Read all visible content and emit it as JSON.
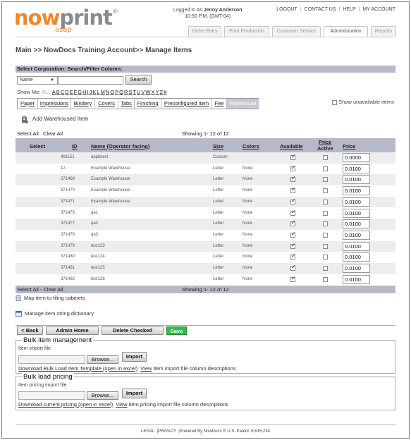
{
  "logo": {
    "now": "now",
    "print": "print",
    "tm": "®",
    "asap": "asap"
  },
  "login": {
    "prefix": "Logged In As:",
    "user": "Jenny Anderson",
    "time": "10:50 P.M. (GMT-04)"
  },
  "toplinks": [
    "LOGOUT",
    "CONTACT US",
    "HELP",
    "MY ACCOUNT"
  ],
  "tabs": [
    "Order Entry",
    "Print Production",
    "Customer Service",
    "Administration",
    "Reports"
  ],
  "active_tab": "Administration",
  "breadcrumb": "Main >> NowDocs Training Account>> Manage Items",
  "select_header": "Select Corporation: Search/Filter Column:",
  "filter": {
    "column": "Name",
    "search_value": "",
    "search_label": "Search"
  },
  "showme": {
    "label": "Show Me:",
    "all": "ALL",
    "letters": [
      "A",
      "B",
      "C",
      "D",
      "E",
      "F",
      "G",
      "H",
      "I",
      "J",
      "K",
      "L",
      "M",
      "N",
      "O",
      "P",
      "Q",
      "R",
      "S",
      "T",
      "U",
      "V",
      "W",
      "X",
      "Y",
      "Z",
      "#"
    ]
  },
  "category_tabs": [
    "Paper",
    "Impressions",
    "Bindery",
    "Covers",
    "Tabs",
    "Finishing",
    "Preconfigured Item",
    "Fee",
    "Warehouse"
  ],
  "active_category": "Warehouse",
  "show_unavailable_label": "Show unavailable items",
  "add_item_label": "Add Warehoused Item",
  "grid": {
    "select_all": "Select All",
    "clear_all": "Clear All",
    "showing": "Showing 1- 12 of 12",
    "bottom_select": "Select All  - Clear All",
    "headers": {
      "select": "Select",
      "id": "ID",
      "name": "Name (Operator facing)",
      "size": "Size",
      "colors": "Colors",
      "available": "Available",
      "price_active_1": "Price",
      "price_active_2": "Active",
      "price": "Price"
    },
    "rows": [
      {
        "id": "491151",
        "name": "appletest",
        "size": "Custom",
        "colors": "",
        "available": true,
        "price_active": false,
        "price": "0.0000"
      },
      {
        "id": "12",
        "name": "Example Warehouse",
        "size": "Letter",
        "colors": "None",
        "available": true,
        "price_active": false,
        "price": "0.0100"
      },
      {
        "id": "371469",
        "name": "Example Warehouse",
        "size": "Letter",
        "colors": "None",
        "available": true,
        "price_active": false,
        "price": "0.0100"
      },
      {
        "id": "371470",
        "name": "Example Warehouse",
        "size": "Letter",
        "colors": "None",
        "available": true,
        "price_active": false,
        "price": "0.0100"
      },
      {
        "id": "371471",
        "name": "Example Warehouse",
        "size": "Letter",
        "colors": "None",
        "available": true,
        "price_active": false,
        "price": "0.0100"
      },
      {
        "id": "371476",
        "name": "qa1",
        "size": "Letter",
        "colors": "None",
        "available": true,
        "price_active": false,
        "price": "0.0100"
      },
      {
        "id": "371477",
        "name": "qa2",
        "size": "Letter",
        "colors": "None",
        "available": true,
        "price_active": false,
        "price": "0.0100"
      },
      {
        "id": "371478",
        "name": "qa3",
        "size": "Letter",
        "colors": "None",
        "available": true,
        "price_active": false,
        "price": "0.0100"
      },
      {
        "id": "371479",
        "name": "test123",
        "size": "Letter",
        "colors": "None",
        "available": true,
        "price_active": false,
        "price": "0.0100"
      },
      {
        "id": "371480",
        "name": "test124",
        "size": "Letter",
        "colors": "None",
        "available": true,
        "price_active": false,
        "price": "0.0100"
      },
      {
        "id": "371481",
        "name": "test125",
        "size": "Letter",
        "colors": "None",
        "available": true,
        "price_active": false,
        "price": "0.0100"
      },
      {
        "id": "371482",
        "name": "test126",
        "size": "Letter",
        "colors": "None",
        "available": true,
        "price_active": false,
        "price": "0.0100"
      }
    ]
  },
  "links": {
    "map_filing": "Map item to filing cabinets",
    "manage_dict": "Manage item string dictionary"
  },
  "actions": {
    "back": "< Back",
    "admin_home": "Admin Home",
    "delete": "Delete Checked",
    "save": "Save"
  },
  "bulk": {
    "legend": "Bulk item management",
    "file_label": "Item import file",
    "browse": "Browse...",
    "import": "Import",
    "download": "Download Bulk Load Item Template (open in excel)",
    "view_link": "View",
    "view_rest": "item import file column descriptions"
  },
  "pricing": {
    "legend": "Bulk load pricing",
    "file_label": "Item pricing import file",
    "browse": "Browse...",
    "import": "Import",
    "download": "Download current pricing (open in excel)",
    "view_link": "View",
    "view_rest": "item pricing import file column descriptions"
  },
  "footer": {
    "legal": "LEGAL",
    "privacy": "PRIVACY",
    "powered": "Powered By NowDocs ® U.S. Patent: 6,615,234"
  },
  "colors": {
    "brand_orange": "#f0862a",
    "header_band": "#b6b9c9",
    "save_green": "#2fbf4a"
  }
}
